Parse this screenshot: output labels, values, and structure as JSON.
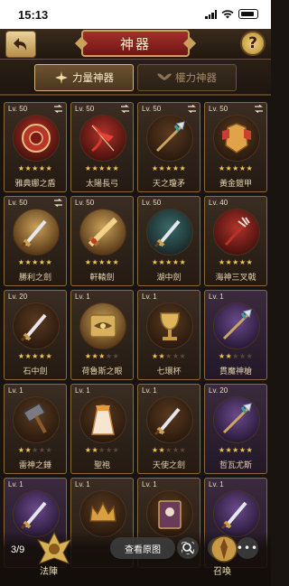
{
  "status": {
    "time": "15:13"
  },
  "header": {
    "title": "神器",
    "help": "?"
  },
  "tabs": [
    {
      "label": "力量神器",
      "active": true
    },
    {
      "label": "權力神器",
      "active": false
    }
  ],
  "items": [
    {
      "level": "Lv. 50",
      "stars": 5,
      "name": "雅典娜之盾",
      "orb": "red",
      "swap": true,
      "icon": "shield-icon"
    },
    {
      "level": "Lv. 50",
      "stars": 5,
      "name": "太陽長弓",
      "orb": "red",
      "swap": true,
      "icon": "bow-icon"
    },
    {
      "level": "Lv. 50",
      "stars": 5,
      "name": "天之瓊矛",
      "orb": "default",
      "swap": true,
      "icon": "spear-icon"
    },
    {
      "level": "Lv. 50",
      "stars": 5,
      "name": "黃金鎧甲",
      "orb": "default",
      "swap": true,
      "icon": "armor-icon"
    },
    {
      "level": "Lv. 50",
      "stars": 5,
      "name": "勝利之劍",
      "orb": "gold",
      "swap": true,
      "icon": "sword-icon"
    },
    {
      "level": "Lv. 50",
      "stars": 5,
      "name": "軒轅劍",
      "orb": "gold",
      "swap": false,
      "icon": "greatsword-icon"
    },
    {
      "level": "Lv. 50",
      "stars": 5,
      "name": "湖中劍",
      "orb": "teal",
      "swap": false,
      "icon": "sword-icon"
    },
    {
      "level": "Lv. 40",
      "stars": 5,
      "name": "海神三叉戟",
      "orb": "red",
      "swap": false,
      "icon": "trident-icon"
    },
    {
      "level": "Lv. 20",
      "stars": 5,
      "name": "石中劍",
      "orb": "default",
      "swap": false,
      "icon": "sword-icon"
    },
    {
      "level": "Lv. 1",
      "stars": 3,
      "name": "荷魯斯之眼",
      "orb": "gold",
      "swap": false,
      "icon": "eye-icon"
    },
    {
      "level": "Lv. 1",
      "stars": 2,
      "name": "七環杯",
      "orb": "default",
      "swap": false,
      "icon": "chalice-icon"
    },
    {
      "level": "Lv. 1",
      "stars": 2,
      "name": "貫魔神槍",
      "orb": "violet",
      "swap": false,
      "icon": "spear-icon"
    },
    {
      "level": "Lv. 1",
      "stars": 2,
      "name": "雷神之錘",
      "orb": "default",
      "swap": false,
      "icon": "hammer-icon"
    },
    {
      "level": "Lv. 1",
      "stars": 2,
      "name": "聖袍",
      "orb": "default",
      "swap": false,
      "icon": "robe-icon"
    },
    {
      "level": "Lv. 1",
      "stars": 2,
      "name": "天使之劍",
      "orb": "default",
      "swap": false,
      "icon": "sword-icon"
    },
    {
      "level": "Lv. 20",
      "stars": 5,
      "name": "哲瓦尤斯",
      "orb": "violet",
      "swap": false,
      "icon": "spear-icon"
    },
    {
      "level": "Lv. 1",
      "stars": 0,
      "name": "",
      "orb": "violet",
      "swap": false,
      "icon": "sword-icon"
    },
    {
      "level": "Lv. 1",
      "stars": 0,
      "name": "",
      "orb": "default",
      "swap": false,
      "icon": "crown-icon"
    },
    {
      "level": "Lv. 1",
      "stars": 0,
      "name": "",
      "orb": "default",
      "swap": false,
      "icon": "book-icon"
    },
    {
      "level": "Lv. 1",
      "stars": 0,
      "name": "",
      "orb": "violet",
      "swap": false,
      "icon": "sword-icon"
    }
  ],
  "bottom": {
    "page": "3/9",
    "view_original": "查看原图",
    "left_nav_label": "法陣",
    "right_nav_label": "召喚"
  },
  "colors": {
    "star_on": "#f2c550",
    "star_off": "#5a4a38",
    "frame": "#8a6a3a",
    "title_red": "#a3302b"
  }
}
